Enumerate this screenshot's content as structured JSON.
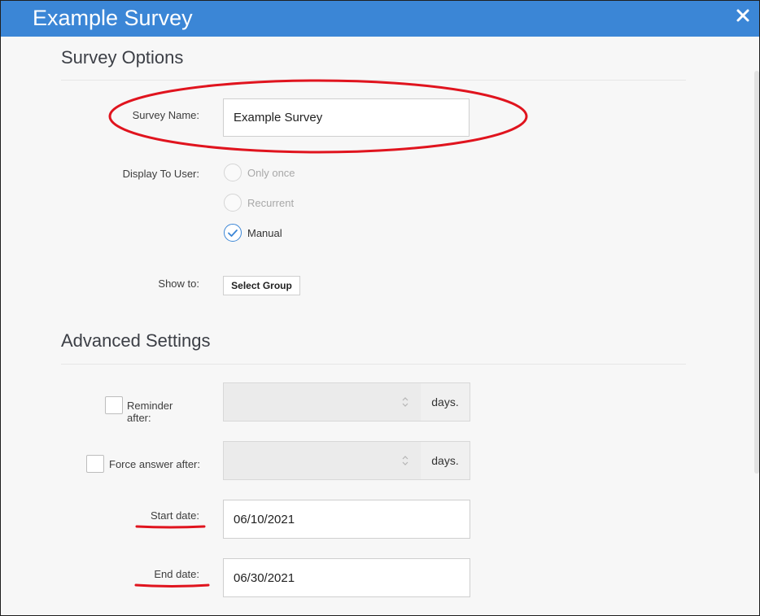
{
  "window": {
    "title": "Example Survey",
    "close_icon": "close-icon"
  },
  "survey_options": {
    "heading": "Survey Options",
    "survey_name": {
      "label": "Survey Name:",
      "value": "Example Survey"
    },
    "display_to_user": {
      "label": "Display To User:",
      "options": [
        {
          "label": "Only once",
          "checked": false
        },
        {
          "label": "Recurrent",
          "checked": false
        },
        {
          "label": "Manual",
          "checked": true
        }
      ]
    },
    "show_to": {
      "label": "Show to:",
      "button": "Select Group"
    }
  },
  "advanced_settings": {
    "heading": "Advanced Settings",
    "reminder": {
      "label": "Reminder after:",
      "value": "",
      "unit": "days."
    },
    "force_answer": {
      "label": "Force answer after:",
      "value": "",
      "unit": "days."
    },
    "start_date": {
      "label": "Start date:",
      "value": "06/10/2021"
    },
    "end_date": {
      "label": "End date:",
      "value": "06/30/2021"
    }
  },
  "colors": {
    "accent": "#3b86d6",
    "annotation": "#e0141e"
  }
}
